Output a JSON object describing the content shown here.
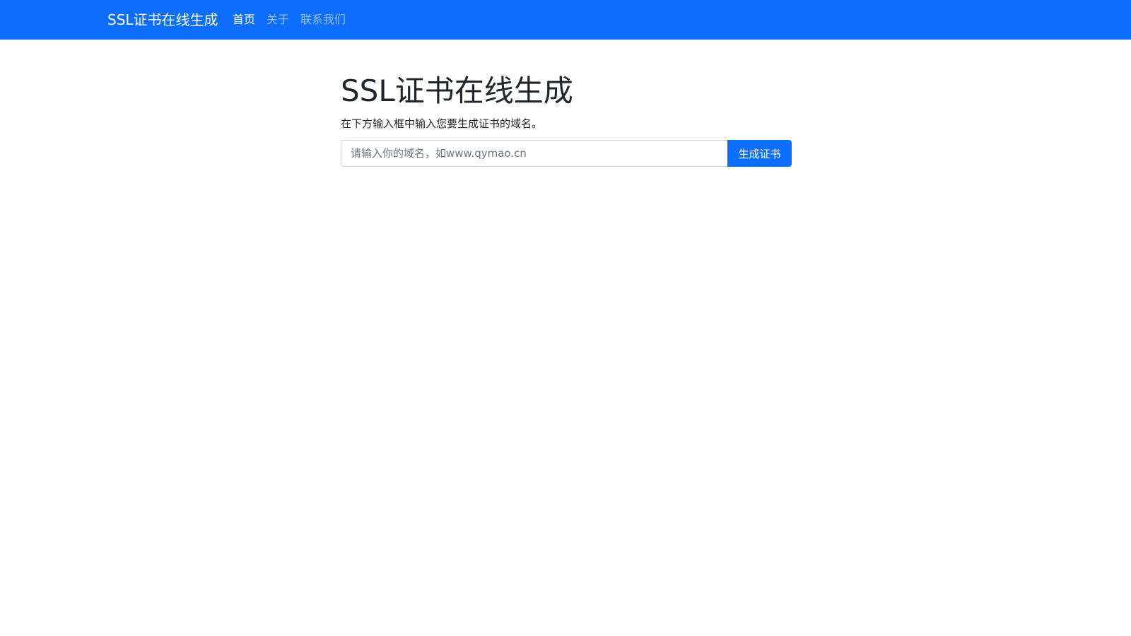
{
  "navbar": {
    "brand": "SSL证书在线生成",
    "items": [
      {
        "label": "首页",
        "active": true
      },
      {
        "label": "关于",
        "active": false
      },
      {
        "label": "联系我们",
        "active": false
      }
    ]
  },
  "main": {
    "title": "SSL证书在线生成",
    "subtitle": "在下方输入框中输入您要生成证书的域名。",
    "input": {
      "placeholder": "请输入你的域名，如www.qymao.cn",
      "value": ""
    },
    "button_label": "生成证书"
  },
  "colors": {
    "primary": "#0d6efd",
    "text": "#212529",
    "placeholder": "#6c757d",
    "border": "#ced4da"
  }
}
